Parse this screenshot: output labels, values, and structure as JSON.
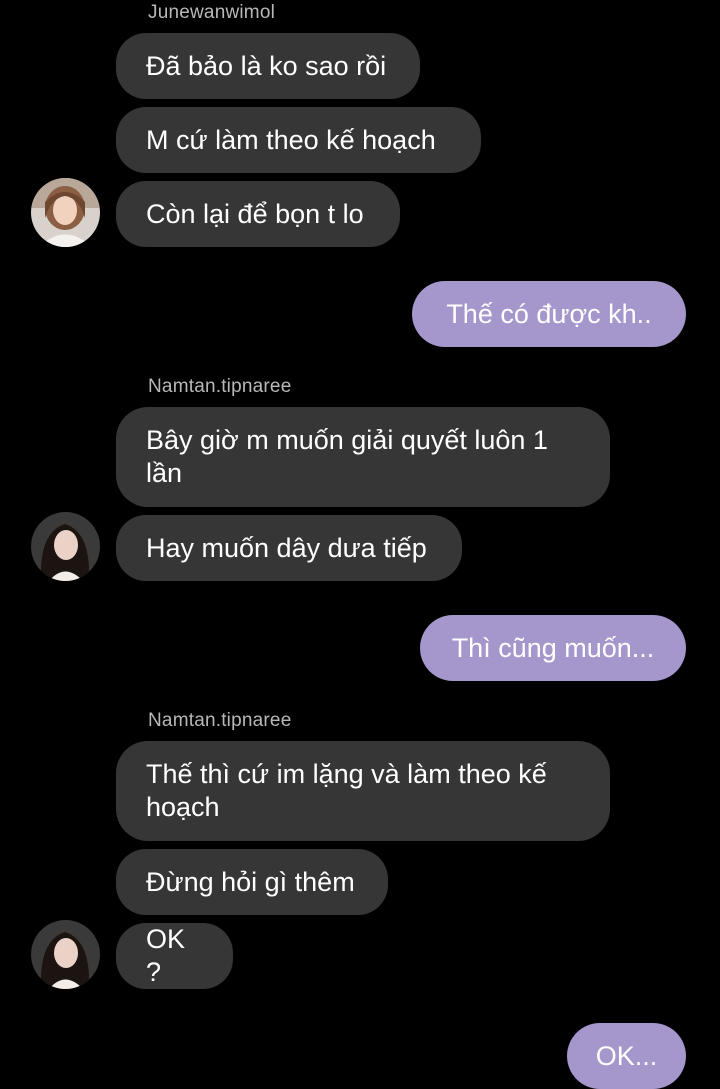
{
  "colors": {
    "background": "#000000",
    "incoming_bubble": "#363636",
    "outgoing_bubble": "#a596cc",
    "sender_name": "#b8b8b8"
  },
  "groups": [
    {
      "sender": "Junewanwimol",
      "avatar_icon": "avatar-junewanwimol",
      "messages": [
        "Đã bảo là ko sao rồi",
        "M cứ làm theo kế hoạch",
        "Còn lại để bọn t lo"
      ]
    },
    {
      "sender": "Namtan.tipnaree",
      "avatar_icon": "avatar-namtan",
      "messages": [
        "Bây giờ m muốn giải quyết luôn 1 lần",
        "Hay muốn dây dưa tiếp"
      ]
    },
    {
      "sender": "Namtan.tipnaree",
      "avatar_icon": "avatar-namtan",
      "messages": [
        "Thế thì cứ im lặng và làm theo kế hoạch",
        "Đừng hỏi gì thêm",
        "OK ?"
      ]
    }
  ],
  "outgoing": [
    "Thế có được kh..",
    "Thì cũng muốn...",
    "OK..."
  ]
}
